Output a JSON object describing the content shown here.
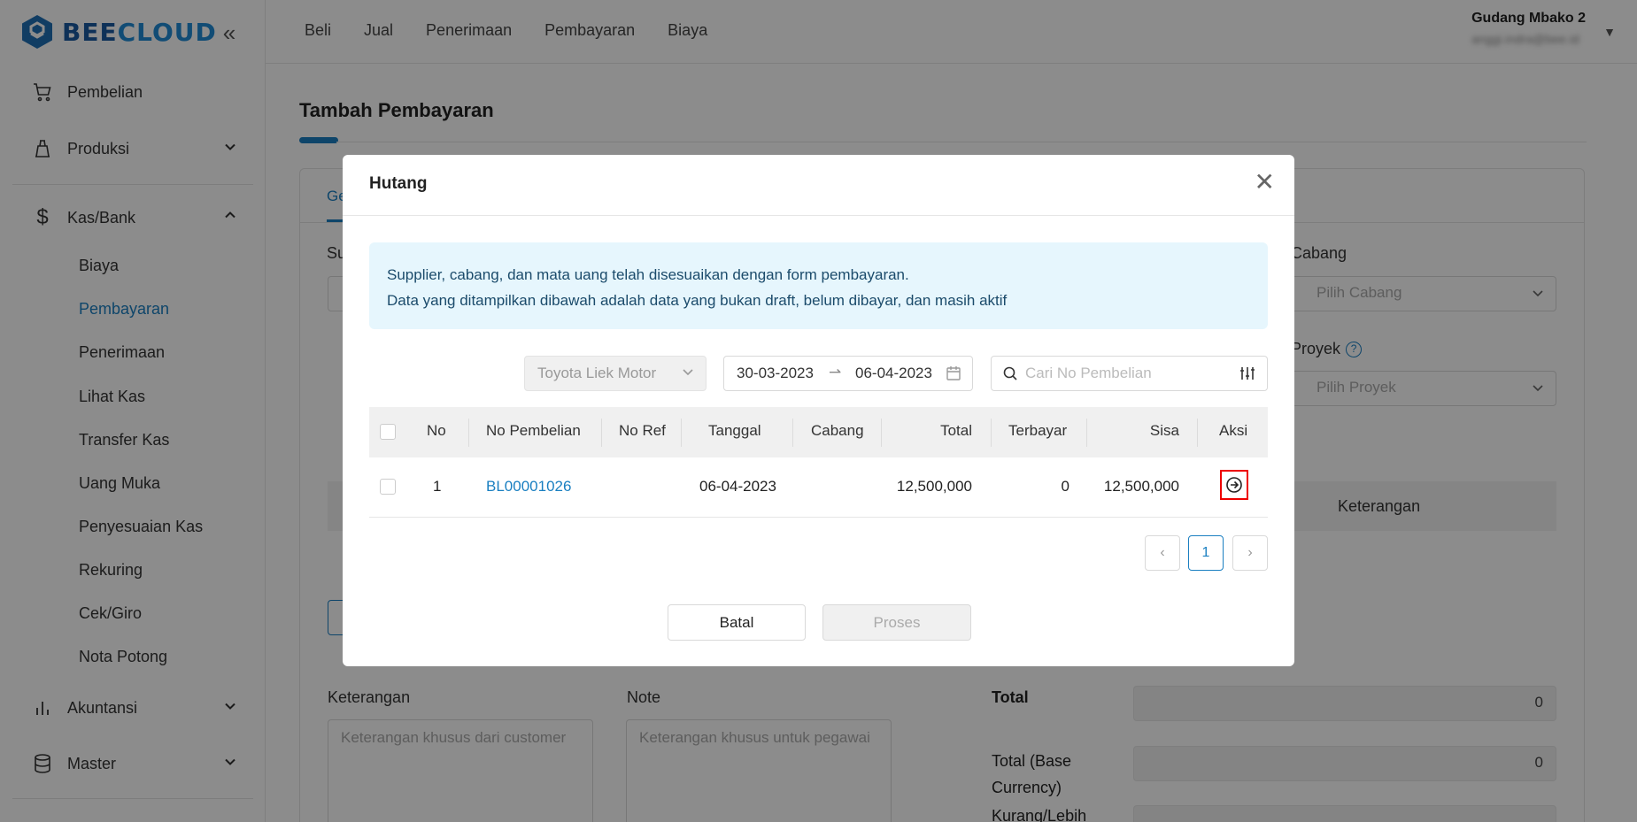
{
  "brand": {
    "part1": "BEE",
    "part2": "CLOUD"
  },
  "sidebar": {
    "items": [
      {
        "label": "Pembelian"
      },
      {
        "label": "Produksi"
      },
      {
        "label": "Kas/Bank"
      },
      {
        "label": "Akuntansi"
      },
      {
        "label": "Master"
      }
    ],
    "kasbank_sub": [
      "Biaya",
      "Pembayaran",
      "Penerimaan",
      "Lihat Kas",
      "Transfer Kas",
      "Uang Muka",
      "Penyesuaian Kas",
      "Rekuring",
      "Cek/Giro",
      "Nota Potong"
    ]
  },
  "topnav": [
    "Beli",
    "Jual",
    "Penerimaan",
    "Pembayaran",
    "Biaya"
  ],
  "user": {
    "name": "Gudang Mbako 2",
    "email": "anggi.indra@bee.id"
  },
  "page": {
    "title": "Tambah Pembayaran",
    "tab_partial": "Ge",
    "supplier_label_partial": "Su",
    "cabang_label": "Cabang",
    "cabang_placeholder": "Pilih Cabang",
    "proyek_label": "Proyek",
    "proyek_help": "?",
    "proyek_placeholder": "Pilih Proyek",
    "keterangan_head": "Keterangan",
    "keterangan_label": "Keterangan",
    "keterangan_placeholder": "Keterangan khusus dari customer",
    "note_label": "Note",
    "note_placeholder": "Keterangan khusus untuk pegawai",
    "total_label": "Total",
    "total_value": "0",
    "total_base_label_1": "Total (Base",
    "total_base_label_2": "Currency)",
    "total_base_value": "0",
    "kurang_label": "Kurang/Lebih"
  },
  "modal": {
    "title": "Hutang",
    "close": "✕",
    "alert_line1": "Supplier, cabang, dan mata uang telah disesuaikan dengan form pembayaran.",
    "alert_line2": "Data yang ditampilkan dibawah adalah data yang bukan draft, belum dibayar, dan masih aktif",
    "supplier_value": "Toyota Liek Motor",
    "date_from": "30-03-2023",
    "date_to": "06-04-2023",
    "search_placeholder": "Cari No Pembelian",
    "columns": [
      "No",
      "No Pembelian",
      "No Ref",
      "Tanggal",
      "Cabang",
      "Total",
      "Terbayar",
      "Sisa",
      "Aksi"
    ],
    "rows": [
      {
        "no": "1",
        "no_pembelian": "BL00001026",
        "no_ref": "",
        "tanggal": "06-04-2023",
        "cabang": "",
        "total": "12,500,000",
        "terbayar": "0",
        "sisa": "12,500,000"
      }
    ],
    "page_current": "1",
    "cancel_label": "Batal",
    "process_label": "Proses"
  },
  "colors": {
    "accent": "#1a7fc1",
    "highlight": "#e00000"
  }
}
